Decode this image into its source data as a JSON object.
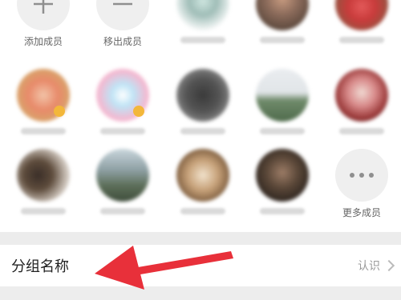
{
  "members": {
    "add_label": "添加成员",
    "remove_label": "移出成员",
    "more_label": "更多成员"
  },
  "settings_row": {
    "title": "分组名称",
    "value": "认识"
  },
  "colors": {
    "accent_arrow": "#e8303a",
    "panel_bg": "#ffffff",
    "page_bg": "#efefef"
  },
  "icons": [
    "plus-icon",
    "minus-icon",
    "more-dots-icon",
    "chevron-right-icon",
    "red-arrow-annotation"
  ]
}
